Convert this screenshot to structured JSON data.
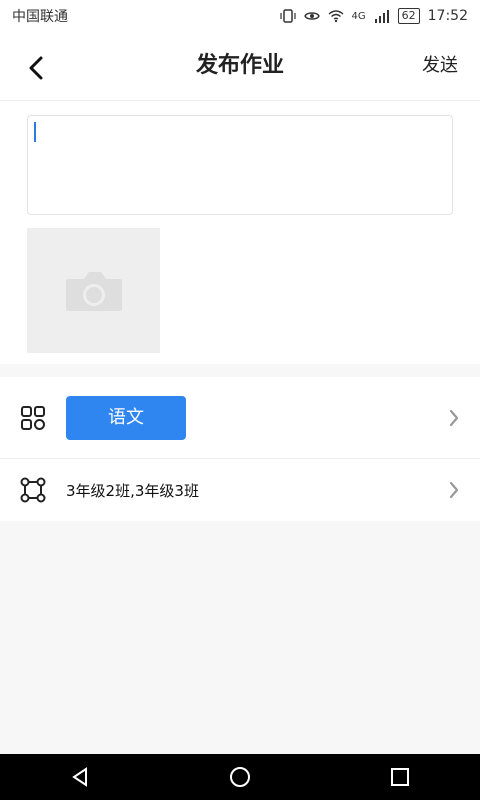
{
  "status": {
    "carrier": "中国联通",
    "network": "4G",
    "battery": "62",
    "time": "17:52"
  },
  "header": {
    "title": "发布作业",
    "send_label": "发送"
  },
  "editor": {
    "content": ""
  },
  "selection": {
    "subject": "语文",
    "classes": "3年级2班,3年级3班"
  },
  "colors": {
    "primary": "#2f86f0",
    "caret": "#2e7be0",
    "placeholder_bg": "#eeeeee"
  },
  "icons": {
    "back": "chevron-left-icon",
    "camera": "camera-icon",
    "subject": "grid-icon",
    "classes": "group-icon",
    "chevron": "chevron-right-icon"
  }
}
